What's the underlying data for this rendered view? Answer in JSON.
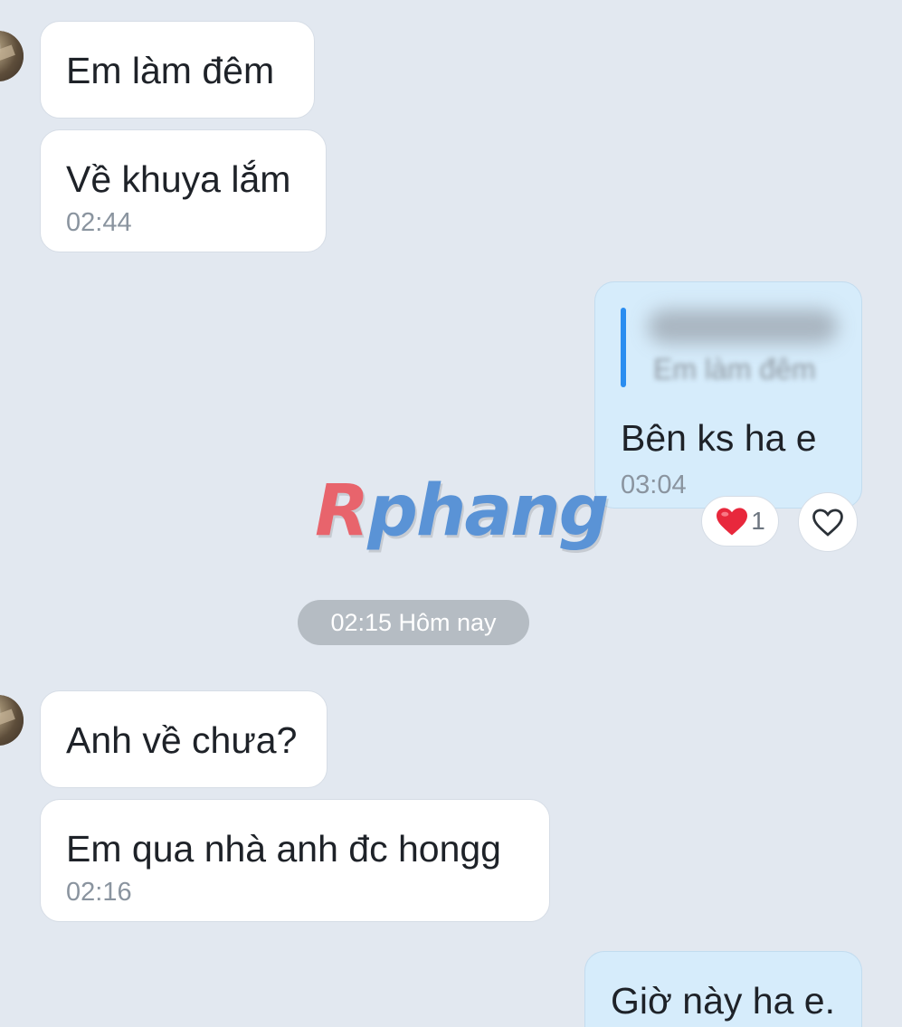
{
  "conversation": {
    "earlier": [
      {
        "text": "Em làm đêm"
      },
      {
        "text": "Về khuya lắm",
        "time": "02:44"
      }
    ],
    "reply": {
      "quoted_text": "Em làm đêm",
      "text": "Bên ks ha e",
      "time": "03:04",
      "reaction_count": "1"
    },
    "date_separator": "02:15 Hôm nay",
    "later": [
      {
        "text": "Anh về chưa?"
      },
      {
        "text": "Em qua nhà anh đc hongg",
        "time": "02:16"
      }
    ],
    "last_sent": {
      "text": "Giờ này ha e."
    }
  },
  "watermark": {
    "part1": "R",
    "part2": "phang"
  },
  "icons": {
    "reaction": "heart-filled-icon",
    "react_button": "heart-outline-icon"
  },
  "colors": {
    "background": "#e2e8f0",
    "incoming_bubble": "#ffffff",
    "outgoing_bubble": "#d6ecfb",
    "quote_bar": "#2a8df0",
    "heart": "#e8283c"
  }
}
